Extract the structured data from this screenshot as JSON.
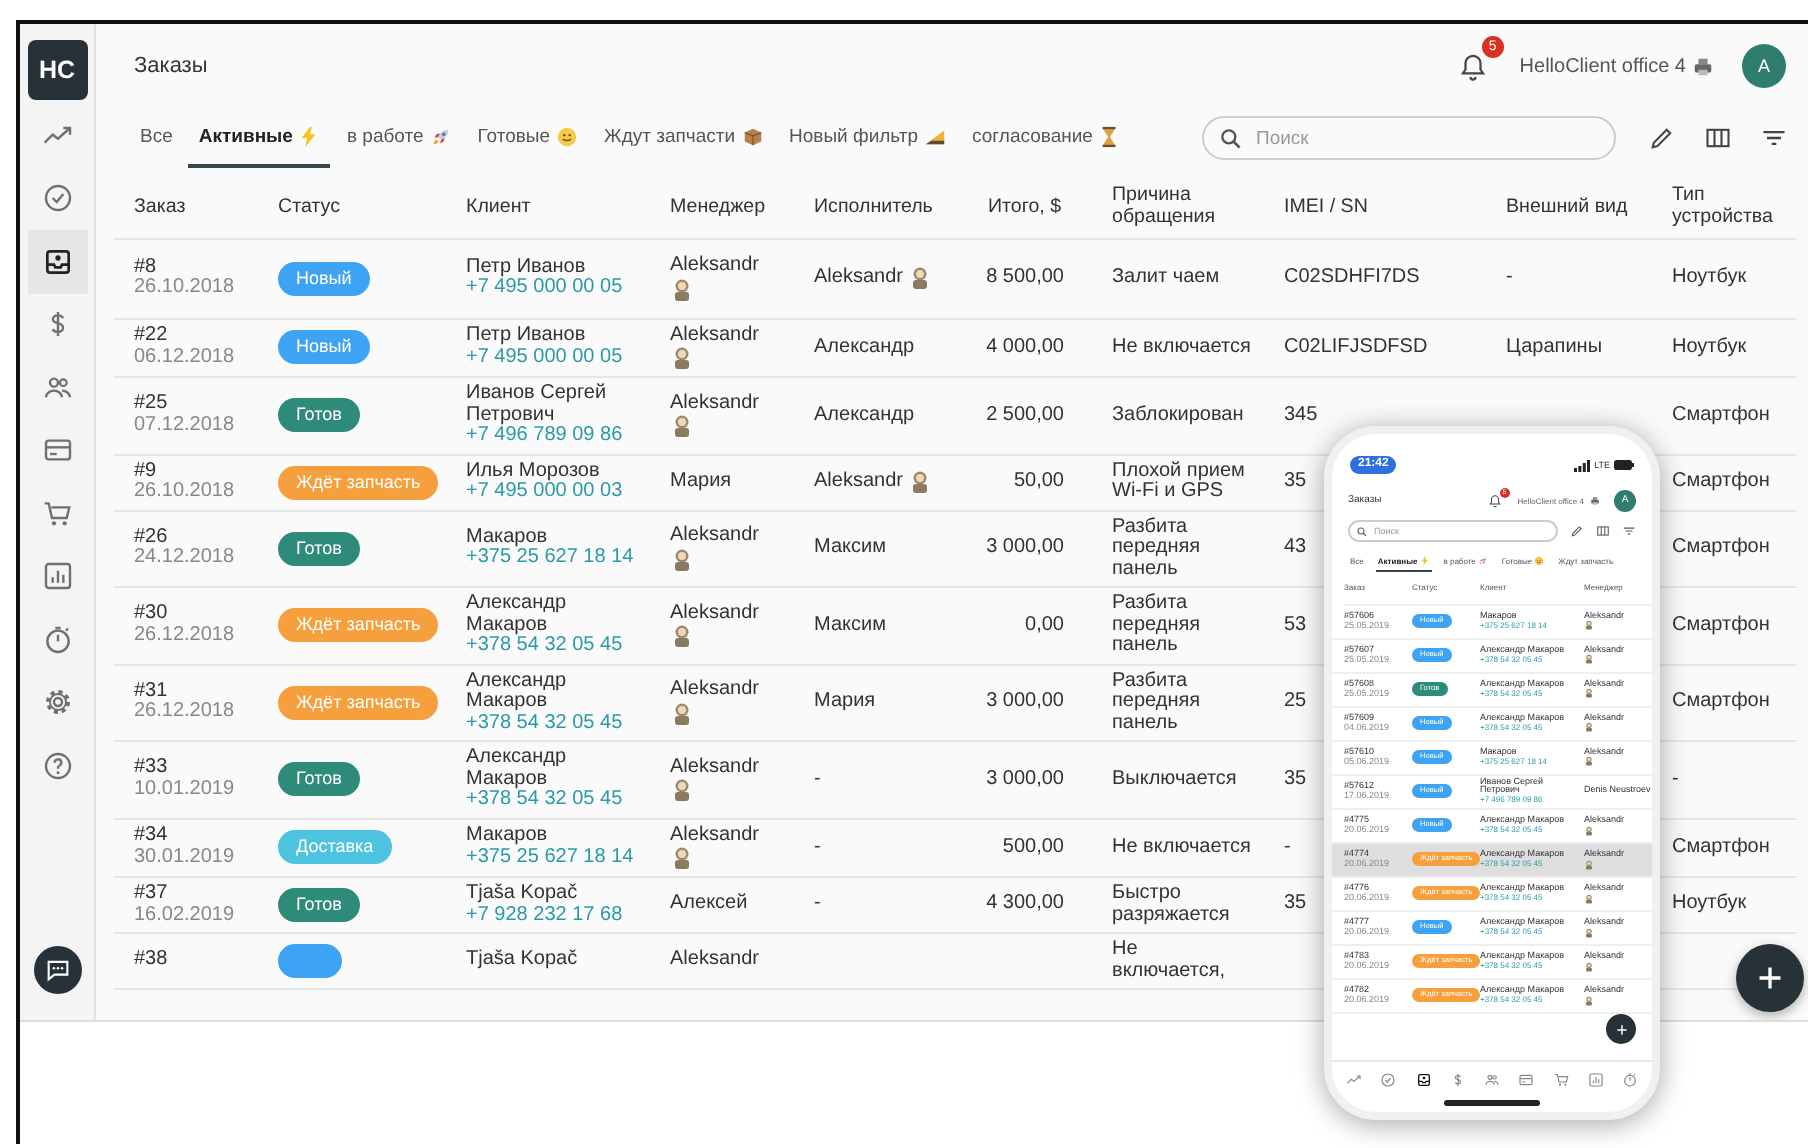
{
  "sidebar": {
    "logo": "HC",
    "items": [
      {
        "kind": "trend",
        "selected": false
      },
      {
        "kind": "check",
        "selected": false
      },
      {
        "kind": "inbox",
        "selected": true
      },
      {
        "kind": "dollar",
        "selected": false
      },
      {
        "kind": "people",
        "selected": false
      },
      {
        "kind": "card",
        "selected": false
      },
      {
        "kind": "cart",
        "selected": false
      },
      {
        "kind": "chart",
        "selected": false
      },
      {
        "kind": "timer",
        "selected": false
      },
      {
        "kind": "gear",
        "selected": false
      },
      {
        "kind": "help",
        "selected": false
      }
    ]
  },
  "header": {
    "title": "Заказы",
    "notifications": "5",
    "account": "HelloClient office 4",
    "avatar": "A"
  },
  "tabs": [
    {
      "label": "Все",
      "selected": false
    },
    {
      "label": "Активные",
      "kind": "lightning",
      "selected": true
    },
    {
      "label": "в работе",
      "kind": "rocket",
      "selected": false
    },
    {
      "label": "Готовые",
      "kind": "smiley",
      "selected": false
    },
    {
      "label": "Ждут запчасти",
      "kind": "box",
      "selected": false
    },
    {
      "label": "Новый фильтр",
      "kind": "ruler",
      "selected": false
    },
    {
      "label": "согласование",
      "kind": "hourglass",
      "selected": false
    }
  ],
  "search": {
    "placeholder": "Поиск"
  },
  "table": {
    "columns": [
      "Заказ",
      "Статус",
      "Клиент",
      "Менеджер",
      "Исполнитель",
      "Итого, $",
      "Причина обращения",
      "IMEI / SN",
      "Внешний вид",
      "Тип устройства"
    ],
    "rows": [
      {
        "order": "#8",
        "date": "26.10.2018",
        "status": {
          "label": "Новый",
          "color": "#3ea3f2"
        },
        "client": "Петр Иванов",
        "phone": "+7 495 000 00 05",
        "manager": {
          "name": "Aleksandr",
          "icon": true
        },
        "executor": {
          "name": "Aleksandr",
          "icon": true
        },
        "total": "8 500,00",
        "reason": "Залит чаем",
        "imei": "C02SDHFI7DS",
        "appearance": "-",
        "device": "Ноутбук"
      },
      {
        "order": "#22",
        "date": "06.12.2018",
        "status": {
          "label": "Новый",
          "color": "#3ea3f2"
        },
        "client": "Петр Иванов",
        "phone": "+7 495 000 00 05",
        "manager": {
          "name": "Aleksandr",
          "icon": true
        },
        "executor": {
          "name": "Александр",
          "icon": false
        },
        "total": "4 000,00",
        "reason": "Не включается",
        "imei": "C02LIFJSDFSD",
        "appearance": "Царапины",
        "device": "Ноутбук"
      },
      {
        "order": "#25",
        "date": "07.12.2018",
        "status": {
          "label": "Готов",
          "color": "#2e8b7a"
        },
        "client": "Иванов Сергей Петрович",
        "phone": "+7 496 789 09 86",
        "manager": {
          "name": "Aleksandr",
          "icon": true
        },
        "executor": {
          "name": "Александр",
          "icon": false
        },
        "total": "2 500,00",
        "reason": "Заблокирован",
        "imei": "345",
        "device": "Смартфон"
      },
      {
        "order": "#9",
        "date": "26.10.2018",
        "status": {
          "label": "Ждёт запчасть",
          "color": "#f5a03c"
        },
        "client": "Илья Морозов",
        "phone": "+7 495 000 00 03",
        "manager": {
          "name": "Мария",
          "icon": false
        },
        "executor": {
          "name": "Aleksandr",
          "icon": true
        },
        "total": "50,00",
        "reason": "Плохой прием Wi-Fi и GPS",
        "imei": "35",
        "device": "Смартфон"
      },
      {
        "order": "#26",
        "date": "24.12.2018",
        "status": {
          "label": "Готов",
          "color": "#2e8b7a"
        },
        "client": "Макаров",
        "phone": "+375 25 627 18 14",
        "manager": {
          "name": "Aleksandr",
          "icon": true
        },
        "executor": {
          "name": "Максим",
          "icon": false
        },
        "total": "3 000,00",
        "reason": "Разбита передняя панель",
        "imei": "43",
        "device": "Смартфон"
      },
      {
        "order": "#30",
        "date": "26.12.2018",
        "status": {
          "label": "Ждёт запчасть",
          "color": "#f5a03c"
        },
        "client": "Александр Макаров",
        "phone": "+378 54 32 05 45",
        "manager": {
          "name": "Aleksandr",
          "icon": true
        },
        "executor": {
          "name": "Максим",
          "icon": false
        },
        "total": "0,00",
        "reason": "Разбита передняя панель",
        "imei": "53",
        "device": "Смартфон"
      },
      {
        "order": "#31",
        "date": "26.12.2018",
        "status": {
          "label": "Ждёт запчасть",
          "color": "#f5a03c"
        },
        "client": "Александр Макаров",
        "phone": "+378 54 32 05 45",
        "manager": {
          "name": "Aleksandr",
          "icon": true
        },
        "executor": {
          "name": "Мария",
          "icon": false
        },
        "total": "3 000,00",
        "reason": "Разбита передняя панель",
        "imei": "25",
        "device": "Смартфон"
      },
      {
        "order": "#33",
        "date": "10.01.2019",
        "status": {
          "label": "Готов",
          "color": "#2e8b7a"
        },
        "client": "Александр Макаров",
        "phone": "+378 54 32 05 45",
        "manager": {
          "name": "Aleksandr",
          "icon": true
        },
        "executor": {
          "name": "-",
          "icon": false
        },
        "total": "3 000,00",
        "reason": "Выключается",
        "imei": "35",
        "device": "-"
      },
      {
        "order": "#34",
        "date": "30.01.2019",
        "status": {
          "label": "Доставка",
          "color": "#4ec3e0"
        },
        "client": "Макаров",
        "phone": "+375 25 627 18 14",
        "manager": {
          "name": "Aleksandr",
          "icon": true
        },
        "executor": {
          "name": "-",
          "icon": false
        },
        "total": "500,00",
        "reason": "Не включается",
        "imei": "-",
        "device": "Смартфон"
      },
      {
        "order": "#37",
        "date": "16.02.2019",
        "status": {
          "label": "Готов",
          "color": "#2e8b7a"
        },
        "client": "Tjaša Kopač",
        "phone": "+7 928 232 17 68",
        "manager": {
          "name": "Алексей",
          "icon": false
        },
        "executor": {
          "name": "-",
          "icon": false
        },
        "total": "4 300,00",
        "reason": "Быстро разряжается",
        "imei": "35",
        "device": "Ноутбук"
      },
      {
        "order": "#38",
        "status": {
          "color": "#3ea3f2"
        },
        "client": "Tjaša Kopač",
        "manager": {
          "name": "Aleksandr",
          "icon": false
        },
        "reason": "Не включается,"
      }
    ]
  },
  "phone": {
    "time": "21:42",
    "network": "LTE",
    "title": "Заказы",
    "notifications": "5",
    "account": "HelloClient office 4",
    "avatar": "A",
    "search": {
      "placeholder": "Поиск"
    },
    "tabs": [
      {
        "label": "Все",
        "selected": false
      },
      {
        "label": "Активные",
        "kind": "lightning",
        "selected": true
      },
      {
        "label": "в работе",
        "kind": "rocket",
        "selected": false
      },
      {
        "label": "Готовые",
        "kind": "smiley",
        "selected": false
      },
      {
        "label": "Ждут запчасть",
        "selected": false
      }
    ],
    "columns": [
      "Заказ",
      "Статус",
      "Клиент",
      "Менеджер"
    ],
    "rows": [
      {
        "order": "#57606",
        "date": "25.05.2019",
        "status": {
          "label": "Новый",
          "color": "#3ea3f2"
        },
        "client": "Макаров",
        "phone": "+375 25 627 18 14",
        "manager": "Aleksandr",
        "icon": true,
        "highlighted": false
      },
      {
        "order": "#57607",
        "date": "25.05.2019",
        "status": {
          "label": "Новый",
          "color": "#3ea3f2"
        },
        "client": "Александр Макаров",
        "phone": "+378 54 32 05 45",
        "manager": "Aleksandr",
        "icon": true,
        "highlighted": false
      },
      {
        "order": "#57608",
        "date": "25.05.2019",
        "status": {
          "label": "Готов",
          "color": "#2e8b7a"
        },
        "client": "Александр Макаров",
        "phone": "+378 54 32 05 45",
        "manager": "Aleksandr",
        "icon": true,
        "highlighted": false
      },
      {
        "order": "#57609",
        "date": "04.06.2019",
        "status": {
          "label": "Новый",
          "color": "#3ea3f2"
        },
        "client": "Александр Макаров",
        "phone": "+378 54 32 05 45",
        "manager": "Aleksandr",
        "icon": true,
        "highlighted": false
      },
      {
        "order": "#57610",
        "date": "05.06.2019",
        "status": {
          "label": "Новый",
          "color": "#3ea3f2"
        },
        "client": "Макаров",
        "phone": "+375 25 627 18 14",
        "manager": "Aleksandr",
        "icon": true,
        "highlighted": false
      },
      {
        "order": "#57612",
        "date": "17.06.2019",
        "status": {
          "label": "Новый",
          "color": "#3ea3f2"
        },
        "client": "Иванов Сергей Петрович",
        "phone": "+7 496 789 09 86",
        "manager": "Denis Neustroev",
        "icon": false,
        "highlighted": false
      },
      {
        "order": "#4775",
        "date": "20.06.2019",
        "status": {
          "label": "Новый",
          "color": "#3ea3f2"
        },
        "client": "Александр Макаров",
        "phone": "+378 54 32 05 45",
        "manager": "Aleksandr",
        "icon": true,
        "highlighted": false
      },
      {
        "order": "#4774",
        "date": "20.06.2019",
        "status": {
          "label": "Ждёт запчасть",
          "color": "#f5a03c"
        },
        "client": "Александр Макаров",
        "phone": "+378 54 32 05 45",
        "manager": "Aleksandr",
        "icon": true,
        "highlighted": true
      },
      {
        "order": "#4776",
        "date": "20.06.2019",
        "status": {
          "label": "Ждёт запчасть",
          "color": "#f5a03c"
        },
        "client": "Александр Макаров",
        "phone": "+378 54 32 05 45",
        "manager": "Aleksandr",
        "icon": true,
        "highlighted": false
      },
      {
        "order": "#4777",
        "date": "20.06.2019",
        "status": {
          "label": "Новый",
          "color": "#3ea3f2"
        },
        "client": "Александр Макаров",
        "phone": "+378 54 32 05 45",
        "manager": "Aleksandr",
        "icon": true,
        "highlighted": false
      },
      {
        "order": "#4783",
        "date": "20.06.2019",
        "status": {
          "label": "Ждёт запчасть",
          "color": "#f5a03c"
        },
        "client": "Александр Макаров",
        "phone": "+378 54 32 05 45",
        "manager": "Aleksandr",
        "icon": true,
        "highlighted": false
      },
      {
        "order": "#4782",
        "date": "20.06.2019",
        "status": {
          "label": "Ждёт запчасть",
          "color": "#f5a03c"
        },
        "client": "Александр Макаров",
        "phone": "+378 54 32 05 45",
        "manager": "Aleksandr",
        "icon": true,
        "highlighted": false
      }
    ],
    "nav": [
      {
        "kind": "trend",
        "selected": false
      },
      {
        "kind": "check",
        "selected": false
      },
      {
        "kind": "inbox",
        "selected": true
      },
      {
        "kind": "dollar",
        "selected": false
      },
      {
        "kind": "people",
        "selected": false
      },
      {
        "kind": "card",
        "selected": false
      },
      {
        "kind": "cart",
        "selected": false
      },
      {
        "kind": "chart",
        "selected": false
      },
      {
        "kind": "timer",
        "selected": false
      }
    ]
  }
}
